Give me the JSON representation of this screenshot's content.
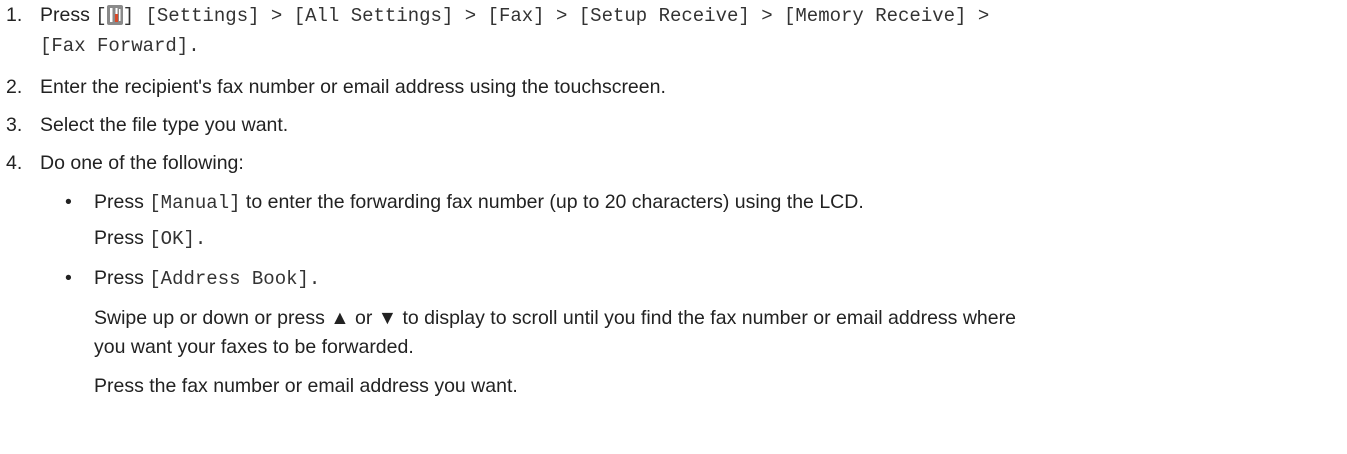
{
  "steps": [
    {
      "number": "1.",
      "press_word": "Press",
      "open_bracket": "[",
      "icon": "settings-tools-icon",
      "path_after_icon": "] [Settings] > [All Settings] > [Fax] > [Setup Receive] > [Memory Receive] >",
      "path_line2": "[Fax Forward]."
    },
    {
      "number": "2.",
      "text": "Enter the recipient's fax number or email address using the touchscreen."
    },
    {
      "number": "3.",
      "text": "Select the file type you want."
    },
    {
      "number": "4.",
      "text": "Do one of the following:"
    }
  ],
  "options": [
    {
      "bullet": "•",
      "press": "Press",
      "key": "[Manual]",
      "rest": "to enter the forwarding fax number (up to 20 characters) using the LCD.",
      "follow_press": "Press",
      "follow_key": "[OK]",
      "follow_end": "."
    },
    {
      "bullet": "•",
      "press": "Press",
      "key": "[Address Book]",
      "end": ".",
      "para1_line1": "Swipe up or down or press ▲ or ▼ to display to scroll until you find the fax number or email address where",
      "para1_line2": "you want your faxes to be forwarded.",
      "para2": "Press the fax number or email address you want."
    }
  ]
}
